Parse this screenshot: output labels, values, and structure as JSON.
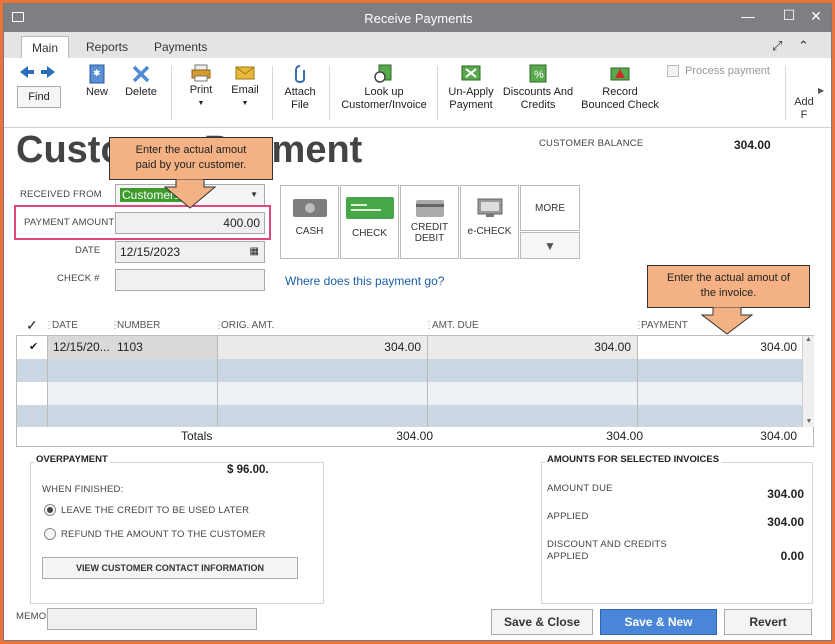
{
  "window": {
    "title": "Receive Payments"
  },
  "tabs": [
    "Main",
    "Reports",
    "Payments"
  ],
  "toolbar": {
    "find": "Find",
    "new": "New",
    "delete": "Delete",
    "print": "Print",
    "email": "Email",
    "attach_1": "Attach",
    "attach_2": "File",
    "lookup_1": "Look up",
    "lookup_2": "Customer/Invoice",
    "unapply_1": "Un-Apply",
    "unapply_2": "Payment",
    "discounts_1": "Discounts And",
    "discounts_2": "Credits",
    "bounced_1": "Record",
    "bounced_2": "Bounced Check",
    "process_payment": "Process payment",
    "add_1": "Add",
    "add_2": "F"
  },
  "form": {
    "title": "Customer Payment",
    "customer_balance_label": "CUSTOMER BALANCE",
    "customer_balance": "304.00",
    "received_from_label": "RECEIVED FROM",
    "received_from": "Customer1",
    "payment_amount_label": "PAYMENT AMOUNT",
    "payment_amount": "400.00",
    "date_label": "DATE",
    "date": "12/15/2023",
    "check_label": "CHECK #",
    "check_no": "",
    "where_link": "Where does this payment go?"
  },
  "methods": {
    "cash": "CASH",
    "check": "CHECK",
    "credit_1": "CREDIT",
    "credit_2": "DEBIT",
    "echeck": "e-CHECK",
    "more": "MORE"
  },
  "table": {
    "headers": {
      "check": "✓",
      "date": "DATE",
      "number": "NUMBER",
      "orig": "ORIG. AMT.",
      "due": "AMT. DUE",
      "payment": "PAYMENT"
    },
    "rows": [
      {
        "check": "✔",
        "date": "12/15/20...",
        "number": "1103",
        "orig": "304.00",
        "due": "304.00",
        "payment": "304.00"
      }
    ],
    "totals": {
      "label": "Totals",
      "orig": "304.00",
      "due": "304.00",
      "payment": "304.00"
    }
  },
  "overpayment": {
    "title": "OVERPAYMENT",
    "amount": "$ 96.00.",
    "when_finished": "WHEN FINISHED:",
    "option_leave": "LEAVE THE CREDIT TO BE USED LATER",
    "option_refund": "REFUND THE AMOUNT TO THE CUSTOMER",
    "view_contact": "VIEW CUSTOMER CONTACT INFORMATION"
  },
  "amounts": {
    "title": "AMOUNTS FOR SELECTED INVOICES",
    "amount_due_label": "AMOUNT DUE",
    "amount_due": "304.00",
    "applied_label": "APPLIED",
    "applied": "304.00",
    "discount_label_1": "DISCOUNT AND CREDITS",
    "discount_label_2": "APPLIED",
    "discount": "0.00"
  },
  "memo_label": "MEMO",
  "buttons": {
    "save_close": "Save & Close",
    "save_new": "Save & New",
    "revert": "Revert"
  },
  "callouts": {
    "payment_1": "Enter the actual amout",
    "payment_2": "paid by your customer.",
    "invoice_1": "Enter the actual amout of",
    "invoice_2": "the invoice."
  },
  "colors": {
    "titlebar": "#7d7f83",
    "accent": "#4a86d8",
    "callout": "#f4b183",
    "highlight": "#e0457b",
    "customer_field": "#3c9b2a"
  }
}
